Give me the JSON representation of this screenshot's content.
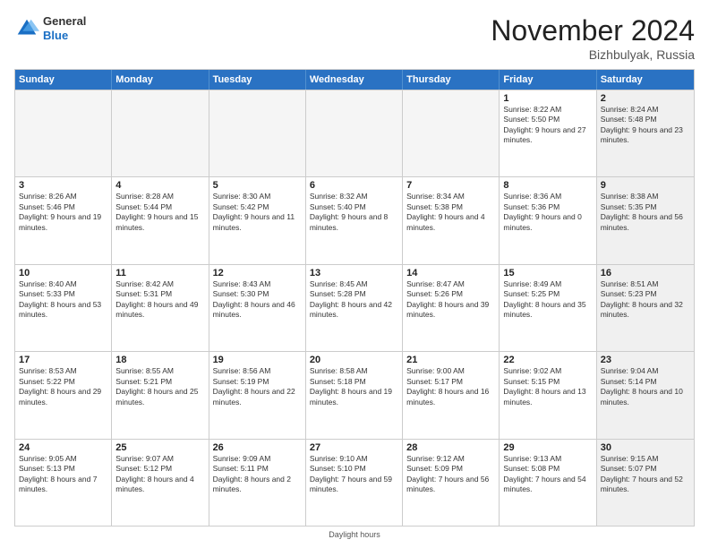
{
  "logo": {
    "general": "General",
    "blue": "Blue"
  },
  "header": {
    "month": "November 2024",
    "location": "Bizhbulyak, Russia"
  },
  "days": [
    "Sunday",
    "Monday",
    "Tuesday",
    "Wednesday",
    "Thursday",
    "Friday",
    "Saturday"
  ],
  "footer": {
    "text": "Daylight hours"
  },
  "weeks": [
    [
      {
        "day": "",
        "empty": true
      },
      {
        "day": "",
        "empty": true
      },
      {
        "day": "",
        "empty": true
      },
      {
        "day": "",
        "empty": true
      },
      {
        "day": "",
        "empty": true
      },
      {
        "day": "1",
        "sunrise": "Sunrise: 8:22 AM",
        "sunset": "Sunset: 5:50 PM",
        "daylight": "Daylight: 9 hours and 27 minutes."
      },
      {
        "day": "2",
        "sunrise": "Sunrise: 8:24 AM",
        "sunset": "Sunset: 5:48 PM",
        "daylight": "Daylight: 9 hours and 23 minutes.",
        "shaded": true
      }
    ],
    [
      {
        "day": "3",
        "sunrise": "Sunrise: 8:26 AM",
        "sunset": "Sunset: 5:46 PM",
        "daylight": "Daylight: 9 hours and 19 minutes."
      },
      {
        "day": "4",
        "sunrise": "Sunrise: 8:28 AM",
        "sunset": "Sunset: 5:44 PM",
        "daylight": "Daylight: 9 hours and 15 minutes."
      },
      {
        "day": "5",
        "sunrise": "Sunrise: 8:30 AM",
        "sunset": "Sunset: 5:42 PM",
        "daylight": "Daylight: 9 hours and 11 minutes."
      },
      {
        "day": "6",
        "sunrise": "Sunrise: 8:32 AM",
        "sunset": "Sunset: 5:40 PM",
        "daylight": "Daylight: 9 hours and 8 minutes."
      },
      {
        "day": "7",
        "sunrise": "Sunrise: 8:34 AM",
        "sunset": "Sunset: 5:38 PM",
        "daylight": "Daylight: 9 hours and 4 minutes."
      },
      {
        "day": "8",
        "sunrise": "Sunrise: 8:36 AM",
        "sunset": "Sunset: 5:36 PM",
        "daylight": "Daylight: 9 hours and 0 minutes."
      },
      {
        "day": "9",
        "sunrise": "Sunrise: 8:38 AM",
        "sunset": "Sunset: 5:35 PM",
        "daylight": "Daylight: 8 hours and 56 minutes.",
        "shaded": true
      }
    ],
    [
      {
        "day": "10",
        "sunrise": "Sunrise: 8:40 AM",
        "sunset": "Sunset: 5:33 PM",
        "daylight": "Daylight: 8 hours and 53 minutes."
      },
      {
        "day": "11",
        "sunrise": "Sunrise: 8:42 AM",
        "sunset": "Sunset: 5:31 PM",
        "daylight": "Daylight: 8 hours and 49 minutes."
      },
      {
        "day": "12",
        "sunrise": "Sunrise: 8:43 AM",
        "sunset": "Sunset: 5:30 PM",
        "daylight": "Daylight: 8 hours and 46 minutes."
      },
      {
        "day": "13",
        "sunrise": "Sunrise: 8:45 AM",
        "sunset": "Sunset: 5:28 PM",
        "daylight": "Daylight: 8 hours and 42 minutes."
      },
      {
        "day": "14",
        "sunrise": "Sunrise: 8:47 AM",
        "sunset": "Sunset: 5:26 PM",
        "daylight": "Daylight: 8 hours and 39 minutes."
      },
      {
        "day": "15",
        "sunrise": "Sunrise: 8:49 AM",
        "sunset": "Sunset: 5:25 PM",
        "daylight": "Daylight: 8 hours and 35 minutes."
      },
      {
        "day": "16",
        "sunrise": "Sunrise: 8:51 AM",
        "sunset": "Sunset: 5:23 PM",
        "daylight": "Daylight: 8 hours and 32 minutes.",
        "shaded": true
      }
    ],
    [
      {
        "day": "17",
        "sunrise": "Sunrise: 8:53 AM",
        "sunset": "Sunset: 5:22 PM",
        "daylight": "Daylight: 8 hours and 29 minutes."
      },
      {
        "day": "18",
        "sunrise": "Sunrise: 8:55 AM",
        "sunset": "Sunset: 5:21 PM",
        "daylight": "Daylight: 8 hours and 25 minutes."
      },
      {
        "day": "19",
        "sunrise": "Sunrise: 8:56 AM",
        "sunset": "Sunset: 5:19 PM",
        "daylight": "Daylight: 8 hours and 22 minutes."
      },
      {
        "day": "20",
        "sunrise": "Sunrise: 8:58 AM",
        "sunset": "Sunset: 5:18 PM",
        "daylight": "Daylight: 8 hours and 19 minutes."
      },
      {
        "day": "21",
        "sunrise": "Sunrise: 9:00 AM",
        "sunset": "Sunset: 5:17 PM",
        "daylight": "Daylight: 8 hours and 16 minutes."
      },
      {
        "day": "22",
        "sunrise": "Sunrise: 9:02 AM",
        "sunset": "Sunset: 5:15 PM",
        "daylight": "Daylight: 8 hours and 13 minutes."
      },
      {
        "day": "23",
        "sunrise": "Sunrise: 9:04 AM",
        "sunset": "Sunset: 5:14 PM",
        "daylight": "Daylight: 8 hours and 10 minutes.",
        "shaded": true
      }
    ],
    [
      {
        "day": "24",
        "sunrise": "Sunrise: 9:05 AM",
        "sunset": "Sunset: 5:13 PM",
        "daylight": "Daylight: 8 hours and 7 minutes."
      },
      {
        "day": "25",
        "sunrise": "Sunrise: 9:07 AM",
        "sunset": "Sunset: 5:12 PM",
        "daylight": "Daylight: 8 hours and 4 minutes."
      },
      {
        "day": "26",
        "sunrise": "Sunrise: 9:09 AM",
        "sunset": "Sunset: 5:11 PM",
        "daylight": "Daylight: 8 hours and 2 minutes."
      },
      {
        "day": "27",
        "sunrise": "Sunrise: 9:10 AM",
        "sunset": "Sunset: 5:10 PM",
        "daylight": "Daylight: 7 hours and 59 minutes."
      },
      {
        "day": "28",
        "sunrise": "Sunrise: 9:12 AM",
        "sunset": "Sunset: 5:09 PM",
        "daylight": "Daylight: 7 hours and 56 minutes."
      },
      {
        "day": "29",
        "sunrise": "Sunrise: 9:13 AM",
        "sunset": "Sunset: 5:08 PM",
        "daylight": "Daylight: 7 hours and 54 minutes."
      },
      {
        "day": "30",
        "sunrise": "Sunrise: 9:15 AM",
        "sunset": "Sunset: 5:07 PM",
        "daylight": "Daylight: 7 hours and 52 minutes.",
        "shaded": true
      }
    ]
  ]
}
